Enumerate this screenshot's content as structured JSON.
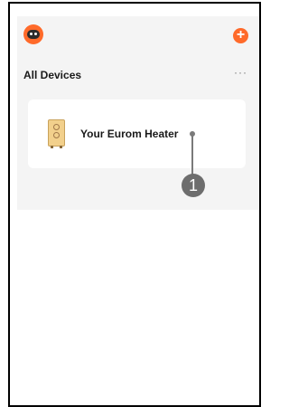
{
  "header": {
    "avatar_icon": "robot-avatar-icon",
    "add_icon": "plus-icon",
    "add_symbol": "+",
    "accent_color": "#ff6a2a"
  },
  "devices_section": {
    "title": "All Devices",
    "more_symbol": "···"
  },
  "devices": [
    {
      "name": "Your Eurom Heater",
      "icon": "heater-icon"
    }
  ],
  "callout": {
    "number": "1"
  }
}
